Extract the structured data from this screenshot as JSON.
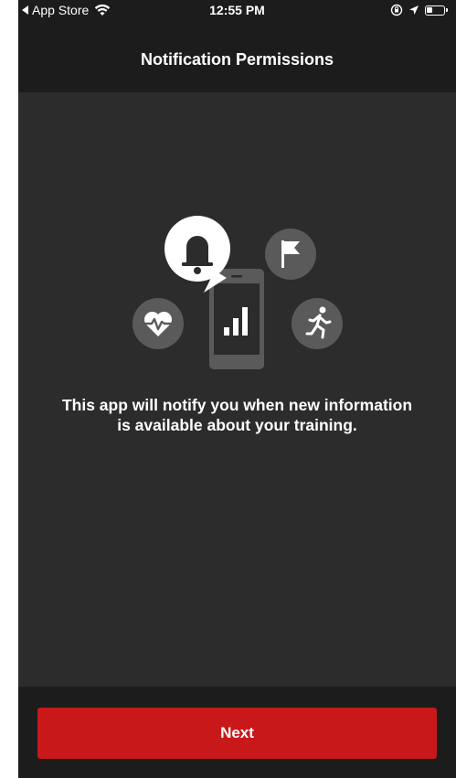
{
  "status_bar": {
    "back_app": "App Store",
    "time": "12:55 PM"
  },
  "nav": {
    "title": "Notification Permissions"
  },
  "content": {
    "message": "This app will notify you when new information is available about your training."
  },
  "actions": {
    "next_label": "Next"
  },
  "colors": {
    "background": "#2c2c2c",
    "bars": "#1c1c1c",
    "accent_red": "#c8181a",
    "icon_gray": "#5a5a5a"
  },
  "icons": [
    "back-arrow-icon",
    "wifi-icon",
    "rotation-lock-icon",
    "location-icon",
    "battery-icon",
    "bell-icon",
    "flag-icon",
    "heart-rate-icon",
    "runner-icon",
    "phone-chart-icon"
  ]
}
